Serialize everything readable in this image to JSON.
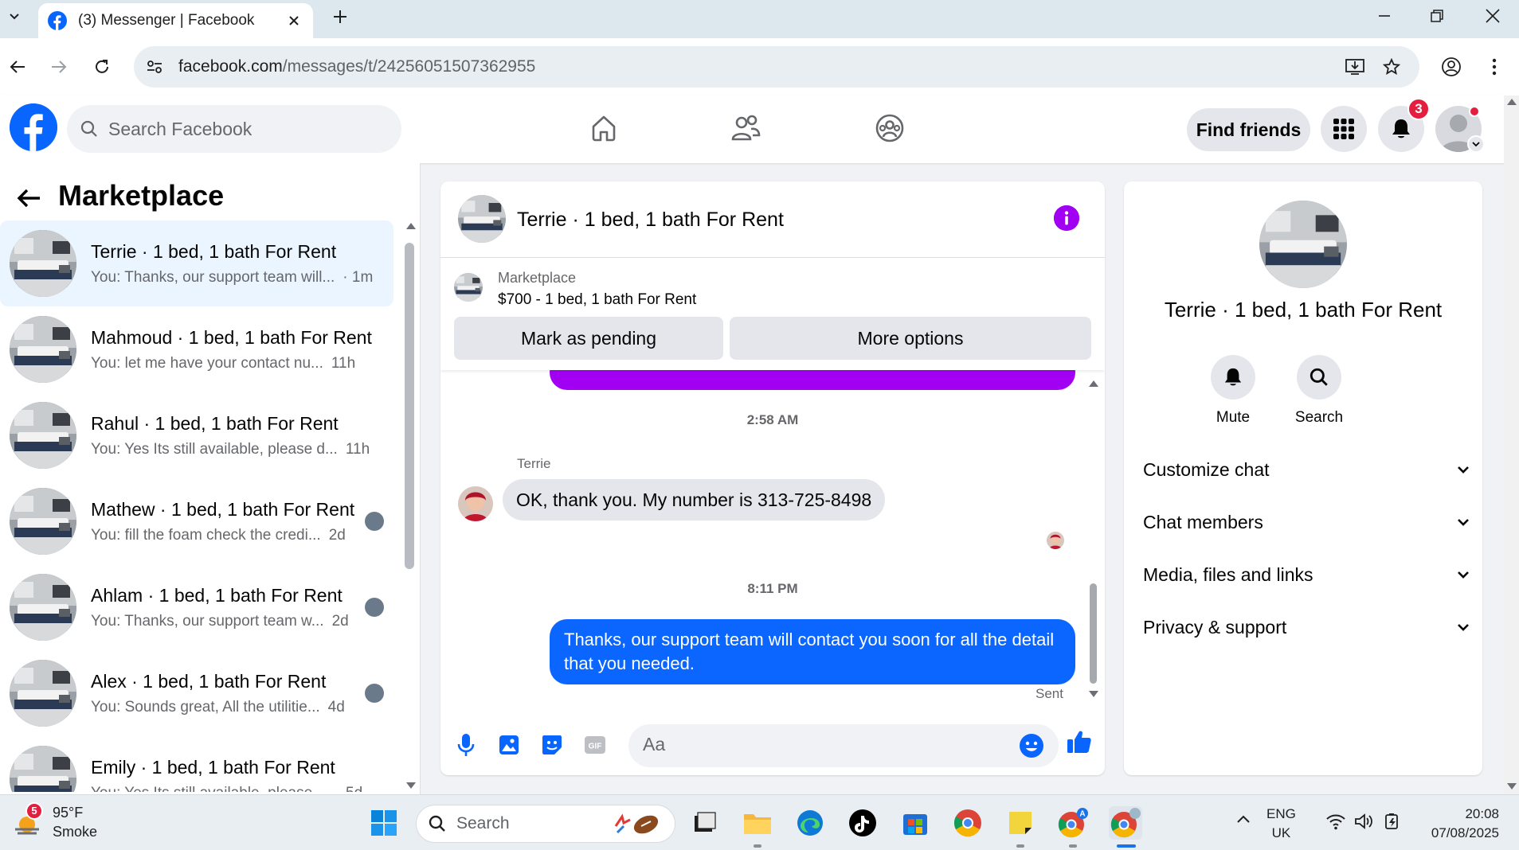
{
  "browser": {
    "tab_title": "(3) Messenger | Facebook",
    "url_host": "facebook.com",
    "url_path": "/messages/t/24256051507362955"
  },
  "header": {
    "search_placeholder": "Search Facebook",
    "find_friends": "Find friends",
    "notification_count": "3"
  },
  "sidebar": {
    "title": "Marketplace",
    "conversations": [
      {
        "name": "Terrie · 1 bed, 1 bath For Rent",
        "preview": "You: Thanks, our support team will...",
        "time": "· 1m"
      },
      {
        "name": "Mahmoud · 1 bed, 1 bath For Rent",
        "preview": "You: let me have your contact nu...",
        "time": "11h"
      },
      {
        "name": "Rahul · 1 bed, 1 bath For Rent",
        "preview": "You: Yes Its still available, please d...",
        "time": "11h"
      },
      {
        "name": "Mathew · 1 bed, 1 bath For Rent",
        "preview": "You: fill the foam check the credi...",
        "time": "2d"
      },
      {
        "name": "Ahlam · 1 bed, 1 bath For Rent",
        "preview": "You: Thanks, our support team w...",
        "time": "2d"
      },
      {
        "name": "Alex · 1 bed, 1 bath For Rent",
        "preview": "You: Sounds great, All the utilitie...",
        "time": "4d"
      },
      {
        "name": "Emily · 1 bed, 1 bath For Rent",
        "preview": "You: Yes Its still available, please dr...",
        "time": "5d"
      }
    ]
  },
  "chat": {
    "title": "Terrie · 1 bed, 1 bath For Rent",
    "marketplace_label": "Marketplace",
    "listing": "$700 - 1 bed, 1 bath For Rent",
    "mark_pending": "Mark as pending",
    "more_options": "More options",
    "time1": "2:58 AM",
    "sender": "Terrie",
    "incoming": "OK, thank you. My number is 313-725-8498",
    "time2": "8:11 PM",
    "outgoing": "Thanks, our support team will contact you soon for all the detail that you needed.",
    "status": "Sent",
    "composer_placeholder": "Aa"
  },
  "details": {
    "name": "Terrie · 1 bed, 1 bath For Rent",
    "mute": "Mute",
    "search": "Search",
    "sections": [
      "Customize chat",
      "Chat members",
      "Media, files and links",
      "Privacy & support"
    ]
  },
  "taskbar": {
    "weather_badge": "5",
    "temperature": "95°F",
    "condition": "Smoke",
    "search_label": "Search",
    "lang1": "ENG",
    "lang2": "UK",
    "time": "20:08",
    "date": "07/08/2025"
  }
}
